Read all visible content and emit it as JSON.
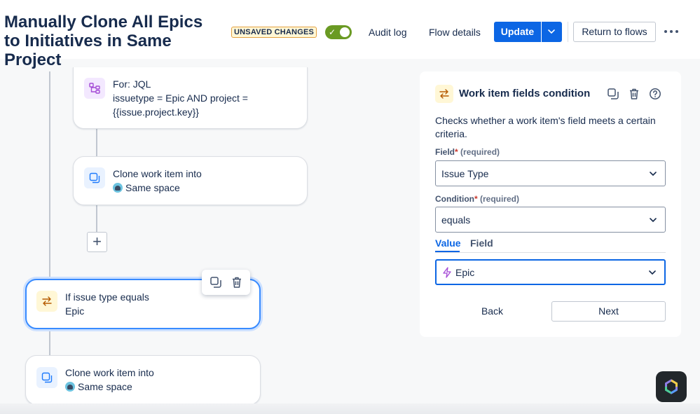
{
  "header": {
    "title": "Manually Clone All Epics to Initiatives in Same Project",
    "status_badge": "UNSAVED CHANGES",
    "toggle_on": true,
    "audit_log": "Audit log",
    "flow_details": "Flow details",
    "update": "Update",
    "return_to_flows": "Return to flows"
  },
  "flow": {
    "for_card": {
      "line1": "For: JQL",
      "line2": "issuetype = Epic AND project =",
      "line3": "{{issue.project.key}}"
    },
    "clone_card_1": {
      "title": "Clone work item into",
      "target": "Same space"
    },
    "if_card": {
      "title": "If issue type equals",
      "value": "Epic"
    },
    "clone_card_2": {
      "title": "Clone work item into",
      "target": "Same space"
    }
  },
  "panel": {
    "title": "Work item fields condition",
    "description": "Checks whether a work item's field meets a certain criteria.",
    "field_label": "Field",
    "condition_label": "Condition",
    "required_text": "(required)",
    "required_mark": "*",
    "field_value": "Issue Type",
    "condition_value": "equals",
    "tabs": [
      "Value",
      "Field"
    ],
    "value_value": "Epic",
    "back": "Back",
    "next": "Next"
  },
  "colors": {
    "primary": "#0c66e4",
    "toggle_on": "#6a9a23",
    "badge_border": "#e2a03f",
    "selected_border": "#388bff"
  }
}
